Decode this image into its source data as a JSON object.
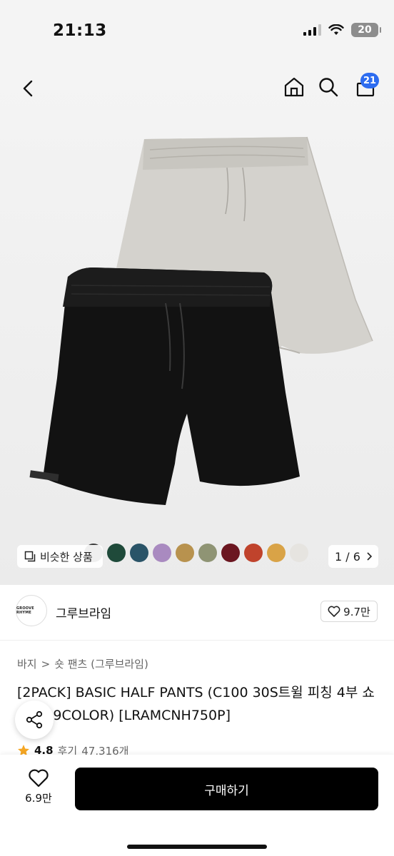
{
  "status_bar": {
    "time": "21:13",
    "battery": "20"
  },
  "nav": {
    "cart_count": "21",
    "icons": [
      "back-icon",
      "home-icon",
      "search-icon",
      "cart-icon"
    ]
  },
  "gallery": {
    "similar_label": "비슷한 상품",
    "page_current": "1",
    "page_total": "6",
    "page_separator": "/",
    "swatch_colors": [
      "#3a3a3a",
      "#1f4a3a",
      "#2a5468",
      "#a98ac0",
      "#b8924e",
      "#8f9474",
      "#6b1620",
      "#c0432c",
      "#d9a347",
      "#e6e4e0"
    ]
  },
  "brand": {
    "logo_text": "GROOVE RHYME",
    "name": "그루브라임",
    "likes": "9.7만"
  },
  "breadcrumb": {
    "category": "바지",
    "separator": ">",
    "subcategory": "숏 팬츠 (그루브라임)"
  },
  "product": {
    "title": "[2PACK] BASIC HALF PANTS (C100 30S트윌 피칭 4부 쇼츠) (19COLOR) [LRAMCNH750P]",
    "rating": "4.8",
    "review_label": "후기",
    "review_count": "47,316개"
  },
  "bottom": {
    "wish_count": "6.9만",
    "buy_label": "구매하기"
  },
  "colors": {
    "accent_badge": "#2d6cf0",
    "star": "#f5a623",
    "buy_button": "#000000"
  }
}
